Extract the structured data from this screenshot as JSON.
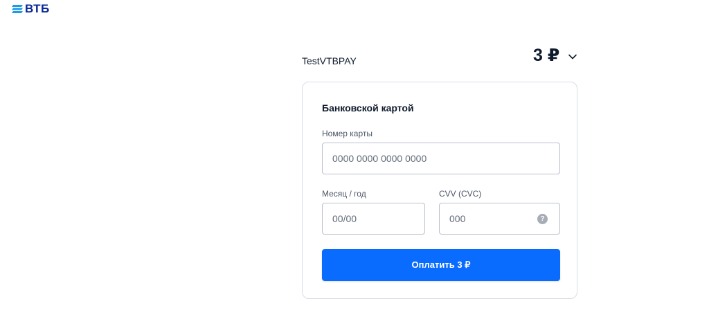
{
  "brand": {
    "logo_text": "ВТБ",
    "logo_icon": "vtb-stripes-icon",
    "color": "#0a2896"
  },
  "order": {
    "merchant": "TestVTBPAY",
    "amount": "3 ₽",
    "expand_icon": "chevron-down-icon"
  },
  "payment_form": {
    "title": "Банковской картой",
    "card_number": {
      "label": "Номер карты",
      "placeholder": "0000 0000 0000 0000",
      "value": ""
    },
    "expiry": {
      "label": "Месяц / год",
      "placeholder": "00/00",
      "value": ""
    },
    "cvv": {
      "label": "CVV (CVC)",
      "placeholder": "000",
      "value": "",
      "help_icon": "question-mark-icon",
      "help_glyph": "?"
    },
    "submit_label": "Оплатить 3 ₽"
  },
  "colors": {
    "primary_button": "#0a6cff",
    "border": "#b9c0cb",
    "text": "#0f1b2d"
  }
}
